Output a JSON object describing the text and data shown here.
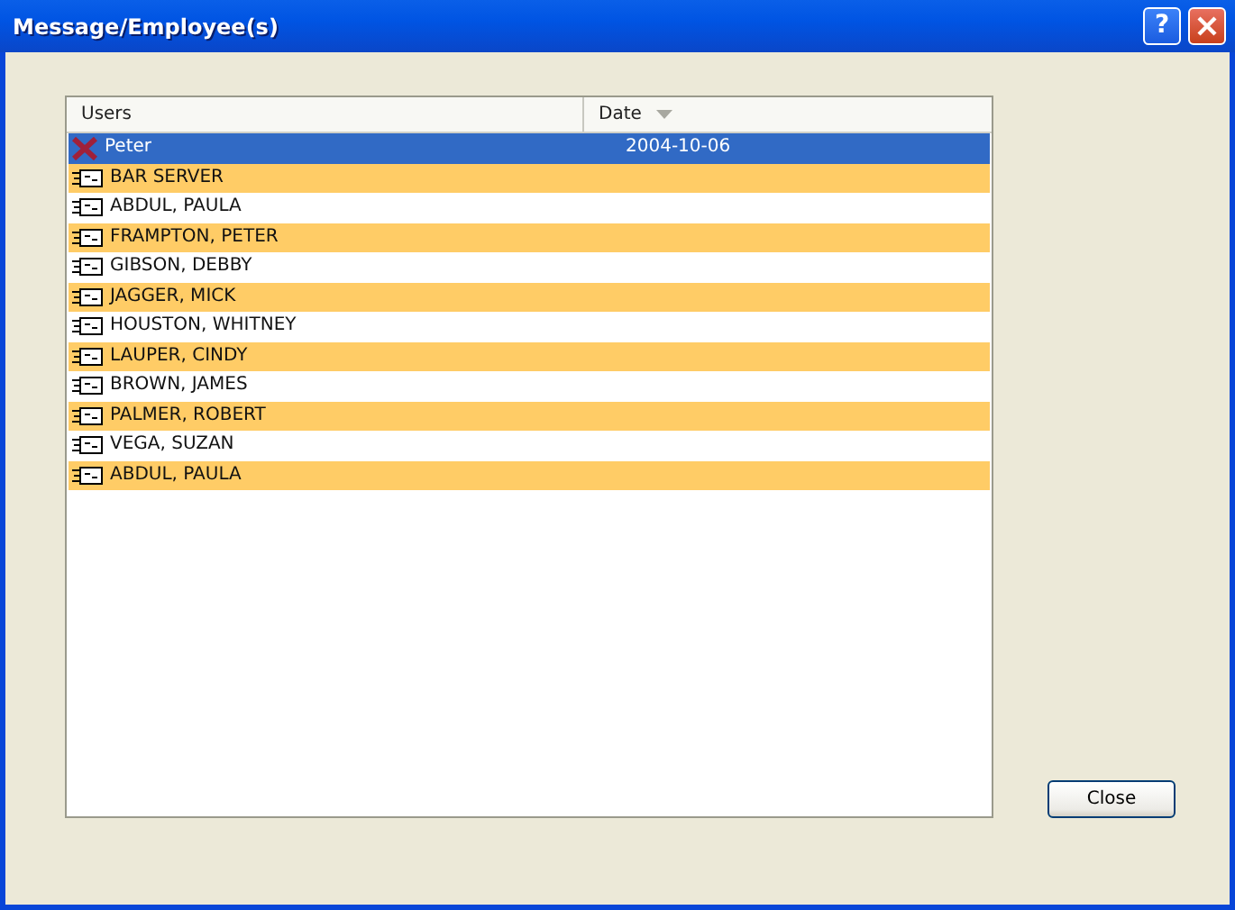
{
  "window": {
    "title": "Message/Employee(s)",
    "help_button": "?"
  },
  "table": {
    "columns": [
      {
        "label": "Users"
      },
      {
        "label": "Date",
        "sorted": true
      }
    ],
    "rows": [
      {
        "kind": "deleted",
        "user": "Peter",
        "date": "2004-10-06",
        "selected": true,
        "highlighted": false
      },
      {
        "kind": "card",
        "user": "BAR SERVER",
        "selected": false,
        "highlighted": true
      },
      {
        "kind": "card",
        "user": "ABDUL, PAULA",
        "selected": false,
        "highlighted": false
      },
      {
        "kind": "card",
        "user": "FRAMPTON, PETER",
        "selected": false,
        "highlighted": true
      },
      {
        "kind": "card",
        "user": "GIBSON, DEBBY",
        "selected": false,
        "highlighted": false
      },
      {
        "kind": "card",
        "user": "JAGGER, MICK",
        "selected": false,
        "highlighted": true
      },
      {
        "kind": "card",
        "user": "HOUSTON, WHITNEY",
        "selected": false,
        "highlighted": false
      },
      {
        "kind": "card",
        "user": "LAUPER, CINDY",
        "selected": false,
        "highlighted": true
      },
      {
        "kind": "card",
        "user": "BROWN, JAMES",
        "selected": false,
        "highlighted": false
      },
      {
        "kind": "card",
        "user": "PALMER, ROBERT",
        "selected": false,
        "highlighted": true
      },
      {
        "kind": "card",
        "user": "VEGA, SUZAN",
        "selected": false,
        "highlighted": false
      },
      {
        "kind": "card",
        "user": "ABDUL, PAULA",
        "selected": false,
        "highlighted": true
      }
    ]
  },
  "buttons": [
    {
      "label": "Close"
    }
  ]
}
